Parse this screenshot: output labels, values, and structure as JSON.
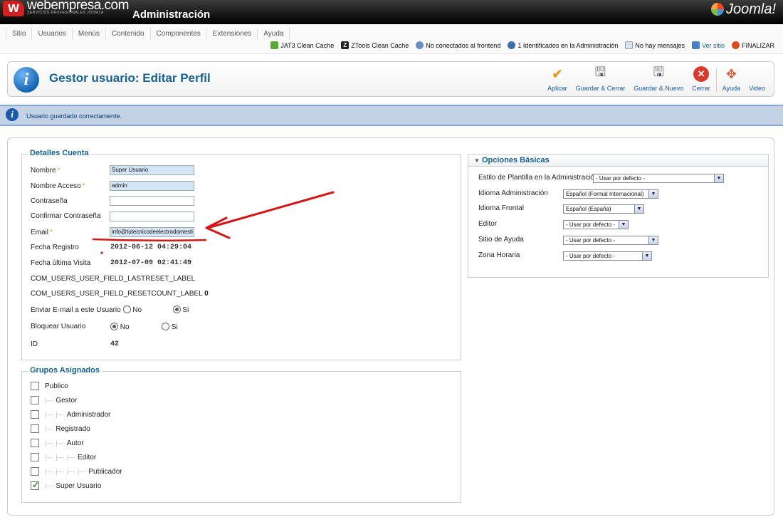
{
  "header": {
    "logo_text": "webempresa.com",
    "logo_subtext": "SERVICIOS PROFESIONALES JOOMLA",
    "title": "Administración",
    "brand": "Joomla!"
  },
  "menu": [
    "Sitio",
    "Usuarios",
    "Menús",
    "Contenido",
    "Componentes",
    "Extensiones",
    "Ayuda"
  ],
  "status": {
    "jat3": "JAT3 Clean Cache",
    "ztools": "ZTools Clean Cache",
    "frontend": "No conectados al frontend",
    "admin": "1 Identificados en la Administración",
    "messages": "No hay mensajes",
    "view_site": "Ver sitio",
    "logout": "FINALIZAR"
  },
  "page_title": "Gestor usuario: Editar Perfil",
  "toolbar": {
    "apply": "Aplicar",
    "save_close": "Guardar & Cerrar",
    "save_new": "Guardar & Nuevo",
    "close": "Cerrar",
    "help": "Ayuda",
    "video": "Video"
  },
  "message": "Usuario guardado correctamente.",
  "account": {
    "legend": "Detalles Cuenta",
    "name_label": "Nombre",
    "name_value": "Super Usuario",
    "username_label": "Nombre Acceso",
    "username_value": "admin",
    "password_label": "Contraseña",
    "password_value": "",
    "confirm_label": "Confirmar Contraseña",
    "confirm_value": "",
    "email_label": "Email",
    "email_value": "info@tutecnicodeelectrodomesti",
    "registered_label": "Fecha Registro",
    "registered_value": "2012-06-12 04:29:04",
    "lastvisit_label": "Fecha última Visita",
    "lastvisit_value": "2012-07-09 02:41:49",
    "lastreset_label": "COM_USERS_USER_FIELD_LASTRESET_LABEL",
    "resetcount_label": "COM_USERS_USER_FIELD_RESETCOUNT_LABEL",
    "resetcount_value": "0",
    "sendemail_label": "Enviar E-mail a este Usuario",
    "block_label": "Bloquear Usuario",
    "no": "No",
    "yes": "Si",
    "id_label": "ID",
    "id_value": "42",
    "required_mark": "*"
  },
  "groups": {
    "legend": "Grupos Asignados",
    "items": [
      {
        "label": "Publico",
        "level": 0,
        "checked": false
      },
      {
        "label": "Gestor",
        "level": 1,
        "checked": false
      },
      {
        "label": "Administrador",
        "level": 2,
        "checked": false
      },
      {
        "label": "Registrado",
        "level": 1,
        "checked": false
      },
      {
        "label": "Autor",
        "level": 2,
        "checked": false
      },
      {
        "label": "Editor",
        "level": 3,
        "checked": false
      },
      {
        "label": "Publicador",
        "level": 4,
        "checked": false
      },
      {
        "label": "Super Usuario",
        "level": 1,
        "checked": true
      }
    ]
  },
  "options": {
    "legend": "Opciones Básicas",
    "template_label": "Estilo de Plantilla en la Administración",
    "template_value": "- Usar por defecto -",
    "admin_lang_label": "Idioma Administración",
    "admin_lang_value": "Español (Formal Internacional)",
    "site_lang_label": "Idioma Frontal",
    "site_lang_value": "Español (España)",
    "editor_label": "Editor",
    "editor_value": "- Usar por defecto -",
    "help_site_label": "Sitio de Ayuda",
    "help_site_value": "- Usar por defecto -",
    "timezone_label": "Zona Horaria",
    "timezone_value": "- Usar por defecto -"
  },
  "colors": {
    "accent": "#146295",
    "message_bg": "#c3d2e5",
    "annotation": "#d01818"
  }
}
